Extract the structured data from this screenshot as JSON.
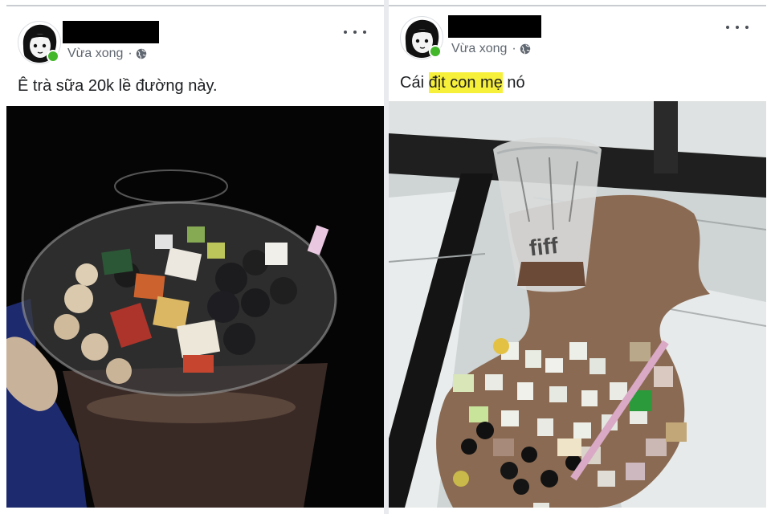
{
  "posts": [
    {
      "time_label": "Vừa xong",
      "separator": "·",
      "caption": "Ê trà sữa 20k lề đường này.",
      "icons": {
        "privacy": "globe-icon",
        "more": "more-options-icon"
      },
      "photo": {
        "subject": "milk tea cup with toppings held in hand at night"
      }
    },
    {
      "time_label": "Vừa xong",
      "separator": "·",
      "caption_before": "Cái ",
      "caption_highlight": "địt con mẹ",
      "caption_after": " nó",
      "icons": {
        "privacy": "globe-icon",
        "more": "more-options-icon"
      },
      "photo": {
        "subject": "spilled milk tea and toppings on tiled floor with empty cup",
        "cup_print": "fiff"
      }
    }
  ],
  "colors": {
    "online": "#42b72a",
    "meta_text": "#606770",
    "caption_text": "#1c1e21",
    "highlight": "#f7f03a",
    "redaction": "#000000"
  }
}
